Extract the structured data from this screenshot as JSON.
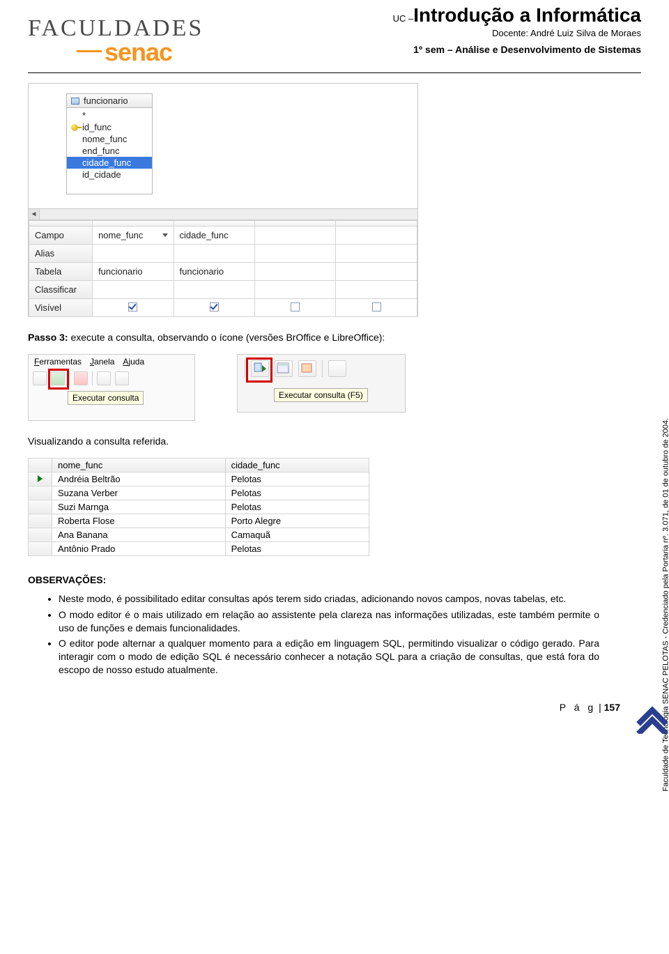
{
  "header": {
    "logo_top": "FACULDADES",
    "logo_bottom": "senac",
    "uc_prefix": "UC –",
    "uc_title": "Introdução a Informática",
    "docente": "Docente: André Luiz Silva de Moraes",
    "sem": "1º sem – Análise e Desenvolvimento de Sistemas"
  },
  "designer": {
    "table_name": "funcionario",
    "fields": [
      "*",
      "id_func",
      "nome_func",
      "end_func",
      "cidade_func",
      "id_cidade"
    ],
    "selected_field_index": 4,
    "key_field_index": 1,
    "rows": [
      "Campo",
      "Alias",
      "Tabela",
      "Classificar",
      "Visível"
    ],
    "cols": [
      {
        "campo": "nome_func",
        "alias": "",
        "tabela": "funcionario",
        "classificar": "",
        "visivel": true,
        "show_caret": true
      },
      {
        "campo": "cidade_func",
        "alias": "",
        "tabela": "funcionario",
        "classificar": "",
        "visivel": true,
        "show_caret": false
      },
      {
        "campo": "",
        "alias": "",
        "tabela": "",
        "classificar": "",
        "visivel": false,
        "show_caret": false
      },
      {
        "campo": "",
        "alias": "",
        "tabela": "",
        "classificar": "",
        "visivel": false,
        "show_caret": false
      }
    ]
  },
  "step3": {
    "label": "Passo 3:",
    "text": " execute a consulta, observando o ícone (versões BrOffice e LibreOffice):"
  },
  "tb1": {
    "menu": [
      "Ferramentas",
      "Janela",
      "Ajuda"
    ],
    "tooltip": "Executar consulta"
  },
  "tb2": {
    "tooltip": "Executar consulta (F5)"
  },
  "viz_text": "Visualizando a consulta referida.",
  "result": {
    "headers": [
      "",
      "nome_func",
      "cidade_func"
    ],
    "rows": [
      {
        "marker": true,
        "nome": "Andréia Beltrão",
        "cidade": "Pelotas"
      },
      {
        "marker": false,
        "nome": "Suzana Verber",
        "cidade": "Pelotas"
      },
      {
        "marker": false,
        "nome": "Suzi Marnga",
        "cidade": "Pelotas"
      },
      {
        "marker": false,
        "nome": "Roberta Flose",
        "cidade": "Porto Alegre"
      },
      {
        "marker": false,
        "nome": "Ana Banana",
        "cidade": "Camaquã"
      },
      {
        "marker": false,
        "nome": "Antônio Prado",
        "cidade": "Pelotas"
      }
    ]
  },
  "observ": {
    "title": "OBSERVAÇÕES:",
    "items": [
      "Neste modo, é possibilitado editar consultas após terem sido criadas, adicionando novos campos, novas tabelas, etc.",
      "O modo editor é o mais utilizado em relação ao assistente pela clareza nas informações utilizadas, este também permite o uso de funções e demais funcionalidades.",
      "O editor pode alternar a qualquer momento para a edição em linguagem SQL, permitindo visualizar o código gerado. Para interagir com o modo de edição SQL é necessário conhecer a notação SQL para a criação de consultas, que está fora do escopo de nosso estudo atualmente."
    ]
  },
  "side": "Faculdade de Tecnologia SENAC PELOTAS - Credenciado pela Portaria nº. 3.071, de 01 de outubro de 2004.",
  "footer": {
    "pag_label": "P á g",
    "sep": " | ",
    "num": "157"
  }
}
